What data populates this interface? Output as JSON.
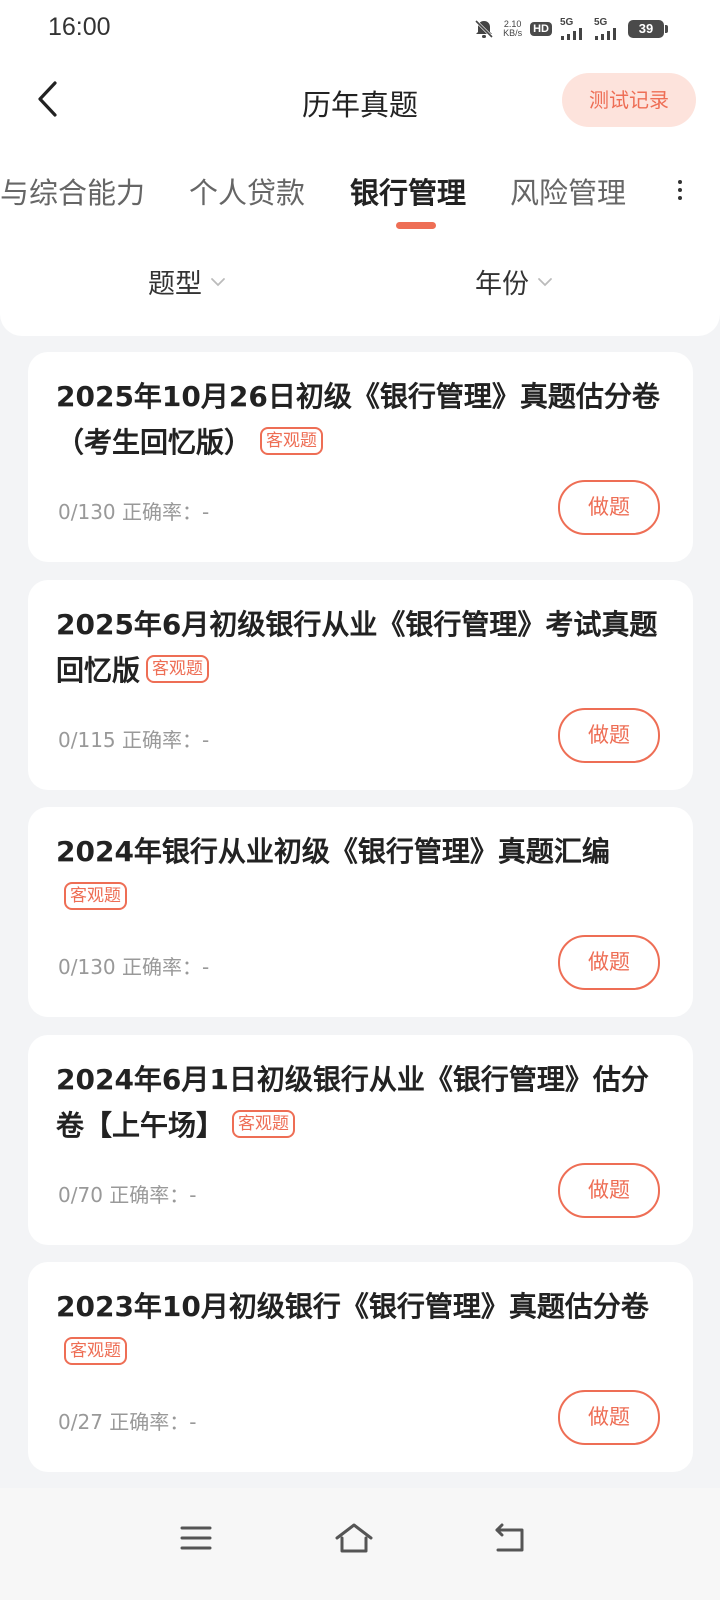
{
  "status_bar": {
    "time": "16:00",
    "net_speed_value": "2.10",
    "net_speed_unit": "KB/s",
    "hd_label": "HD",
    "signal1_label": "5G",
    "signal2_label": "5G",
    "battery": "39"
  },
  "header": {
    "title": "历年真题",
    "test_record_label": "测试记录"
  },
  "tabs": [
    {
      "label": "与综合能力"
    },
    {
      "label": "个人贷款"
    },
    {
      "label": "银行管理"
    },
    {
      "label": "风险管理"
    }
  ],
  "active_tab": "银行管理",
  "filters": {
    "type_label": "题型",
    "year_label": "年份"
  },
  "papers": [
    {
      "title": "2025年10月26日初级《银行管理》真题估分卷（考生回忆版）",
      "tag": "客观题",
      "progress": "0/130",
      "accuracy_label": "正确率：-",
      "button": "做题"
    },
    {
      "title": "2025年6月初级银行从业《银行管理》考试真题回忆版",
      "tag": "客观题",
      "progress": "0/115",
      "accuracy_label": "正确率：-",
      "button": "做题"
    },
    {
      "title": "2024年银行从业初级《银行管理》真题汇编",
      "tag": "客观题",
      "progress": "0/130",
      "accuracy_label": "正确率：-",
      "button": "做题"
    },
    {
      "title": "2024年6月1日初级银行从业《银行管理》估分卷【上午场】",
      "tag": "客观题",
      "progress": "0/70",
      "accuracy_label": "正确率：-",
      "button": "做题"
    },
    {
      "title": "2023年10月初级银行《银行管理》真题估分卷",
      "tag": "客观题",
      "progress": "0/27",
      "accuracy_label": "正确率：-",
      "button": "做题"
    }
  ],
  "colors": {
    "accent": "#ee6e55",
    "accent_light": "#fde3dc",
    "background": "#f3f4f6"
  },
  "icons": {
    "back": "chevron-left-icon",
    "more": "more-vertical-icon",
    "dropdown": "chevron-down-icon",
    "menu": "menu-icon",
    "home": "home-icon",
    "return": "return-icon"
  }
}
